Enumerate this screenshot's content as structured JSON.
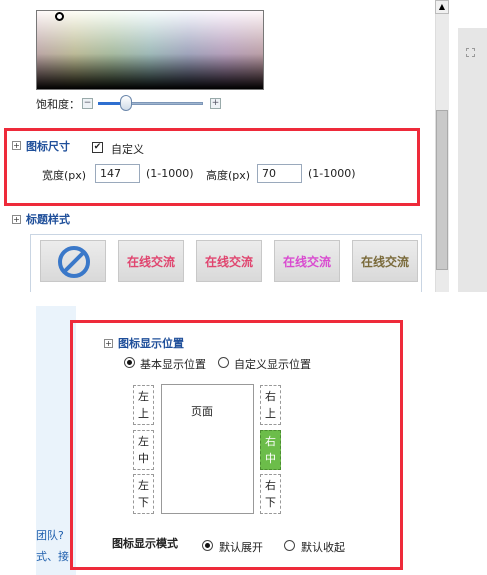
{
  "colors": {
    "accent_red": "#ee2a3a",
    "section_blue": "#1f4f9a",
    "active_green": "#6cbd4a"
  },
  "saturation": {
    "label": "饱和度：",
    "minus_icon": "minus-icon",
    "plus_icon": "plus-icon"
  },
  "icon_size": {
    "title": "图标尺寸",
    "custom_label": "自定义",
    "custom_checked": true,
    "width_label": "宽度(px)",
    "width_value": "147",
    "width_range": "(1-1000)",
    "height_label": "高度(px)",
    "height_value": "70",
    "height_range": "(1-1000)"
  },
  "title_style": {
    "title": "标题样式",
    "tiles": [
      {
        "text": "",
        "icon": "no-entry-icon"
      },
      {
        "text": "在线交流",
        "color": "#e0456f"
      },
      {
        "text": "在线交流",
        "color": "#e0456f"
      },
      {
        "text": "在线交流",
        "color": "#d94bd0"
      },
      {
        "text": "在线交流",
        "color": "#7a6a3a"
      }
    ]
  },
  "display_position": {
    "title": "图标显示位置",
    "basic_label": "基本显示位置",
    "custom_label": "自定义显示位置",
    "selected": "basic",
    "page_label": "页面",
    "positions": {
      "left_top": [
        "左",
        "上"
      ],
      "left_mid": [
        "左",
        "中"
      ],
      "left_bottom": [
        "左",
        "下"
      ],
      "right_top": [
        "右",
        "上"
      ],
      "right_mid": [
        "右",
        "中"
      ],
      "right_bottom": [
        "右",
        "下"
      ]
    },
    "active_position": "right_mid"
  },
  "display_mode": {
    "title": "图标显示模式",
    "expand_label": "默认展开",
    "collapse_label": "默认收起",
    "selected": "expand"
  },
  "left_links": {
    "line1": "团队?",
    "line2": "式、接"
  }
}
